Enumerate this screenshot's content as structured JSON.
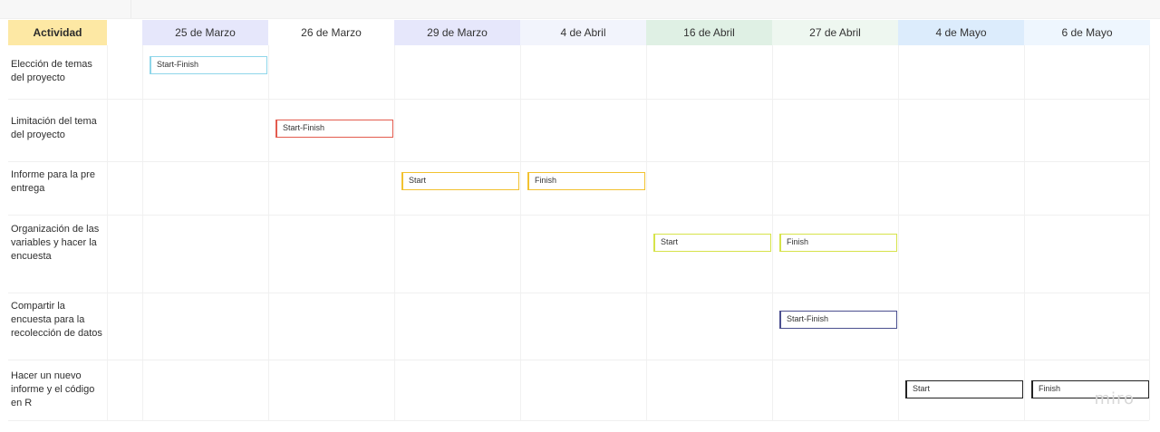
{
  "header": {
    "activity_label": "Actividad",
    "dates": [
      {
        "label": "25 de Marzo",
        "bg": "#e6e7fb"
      },
      {
        "label": "26 de Marzo",
        "bg": "#ffffff"
      },
      {
        "label": "29 de Marzo",
        "bg": "#e6e7fb"
      },
      {
        "label": "4 de Abril",
        "bg": "#f2f4fc"
      },
      {
        "label": "16 de Abril",
        "bg": "#dff0e4"
      },
      {
        "label": "27 de Abril",
        "bg": "#eef7f0"
      },
      {
        "label": "4 de Mayo",
        "bg": "#dcecfc"
      },
      {
        "label": "6 de Mayo",
        "bg": "#eef6fe"
      }
    ]
  },
  "rows": [
    {
      "label": "Elección de temas del proyecto"
    },
    {
      "label": "Limitación del tema del proyecto"
    },
    {
      "label": "Informe para la pre entrega"
    },
    {
      "label": "Organización de las variables y hacer la encuesta"
    },
    {
      "label": "Compartir la encuesta para la recolección de datos"
    },
    {
      "label": "Hacer un nuevo informe y el código en R"
    }
  ],
  "tasks": [
    {
      "text": "Start-Finish",
      "row": 0,
      "col": 0,
      "color": "#8fd6ea"
    },
    {
      "text": "Start-Finish",
      "row": 1,
      "col": 1,
      "color": "#e35b4e"
    },
    {
      "text": "Start",
      "row": 2,
      "col": 2,
      "color": "#f2c230"
    },
    {
      "text": "Finish",
      "row": 2,
      "col": 3,
      "color": "#f2c230"
    },
    {
      "text": "Start",
      "row": 3,
      "col": 4,
      "color": "#d6e34a"
    },
    {
      "text": "Finish",
      "row": 3,
      "col": 5,
      "color": "#d6e34a"
    },
    {
      "text": "Start-Finish",
      "row": 4,
      "col": 5,
      "color": "#4b4f8f"
    },
    {
      "text": "Start",
      "row": 5,
      "col": 6,
      "color": "#222222"
    },
    {
      "text": "Finish",
      "row": 5,
      "col": 7,
      "color": "#222222"
    }
  ],
  "watermark": "miro"
}
